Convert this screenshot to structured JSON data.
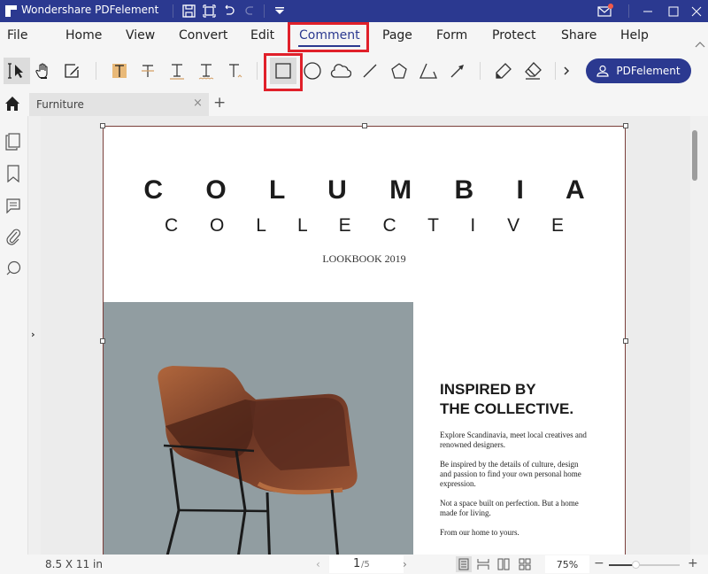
{
  "app": {
    "title": "Wondershare PDFelement",
    "brand_color": "#2b3990",
    "highlight_color": "#e0202a",
    "notification_dot_color": "#f25a4a"
  },
  "quick_access": [
    {
      "icon": "save-icon"
    },
    {
      "icon": "fit-page-icon"
    },
    {
      "icon": "undo-icon"
    },
    {
      "icon": "redo-icon"
    },
    {
      "icon": "customize-dropdown-icon"
    }
  ],
  "window_controls": [
    {
      "icon": "mail-icon",
      "has_notification": true
    },
    {
      "icon": "minimize-icon"
    },
    {
      "icon": "maximize-icon"
    },
    {
      "icon": "close-icon"
    }
  ],
  "menu": {
    "items": [
      {
        "label": "File"
      },
      {
        "label": "Home"
      },
      {
        "label": "View"
      },
      {
        "label": "Convert"
      },
      {
        "label": "Edit"
      },
      {
        "label": "Comment",
        "active": true
      },
      {
        "label": "Page"
      },
      {
        "label": "Form"
      },
      {
        "label": "Protect"
      },
      {
        "label": "Share"
      },
      {
        "label": "Help"
      }
    ],
    "collapse_icon": "chevron-up-icon"
  },
  "toolbar": {
    "tools": [
      {
        "name": "select-tool",
        "icon": "select-cursor-icon",
        "selected": true
      },
      {
        "name": "hand-tool",
        "icon": "hand-icon"
      },
      {
        "name": "edit-tool",
        "icon": "edit-box-icon"
      },
      {
        "name": "highlight-tool",
        "icon": "highlight-icon"
      },
      {
        "name": "strikethrough-tool",
        "icon": "strikethrough-icon"
      },
      {
        "name": "underline-tool",
        "icon": "underline-icon"
      },
      {
        "name": "squiggly-tool",
        "icon": "squiggly-underline-icon"
      },
      {
        "name": "caret-tool",
        "icon": "insert-text-icon"
      },
      {
        "name": "rectangle-tool",
        "icon": "rectangle-icon",
        "selected": true,
        "highlighted": true
      },
      {
        "name": "oval-tool",
        "icon": "circle-icon"
      },
      {
        "name": "cloud-tool",
        "icon": "cloud-icon"
      },
      {
        "name": "line-tool",
        "icon": "line-icon"
      },
      {
        "name": "polygon-tool",
        "icon": "pentagon-icon"
      },
      {
        "name": "polyline-tool",
        "icon": "polyline-icon"
      },
      {
        "name": "arrow-tool",
        "icon": "arrow-icon"
      },
      {
        "name": "pencil-tool",
        "icon": "pencil-icon"
      },
      {
        "name": "eraser-tool",
        "icon": "eraser-icon"
      }
    ],
    "more_icon": "chevron-right-icon",
    "account_button_label": "PDFelement"
  },
  "tabs": {
    "items": [
      {
        "label": "Furniture",
        "close": "×"
      }
    ],
    "new_tab": "+"
  },
  "left_panel": {
    "icons": [
      "thumbnails-icon",
      "bookmark-icon",
      "comments-icon",
      "attachment-icon",
      "search-icon"
    ],
    "expand": "›"
  },
  "document": {
    "title": "C O L U M B I A",
    "subtitle": "C O L L E C T I V E",
    "year_line": "LOOKBOOK 2019",
    "heading_line1": "INSPIRED BY",
    "heading_line2": "THE COLLECTIVE.",
    "paragraphs": [
      "Explore Scandinavia, meet local creatives and renowned designers.",
      "Be inspired by the details of culture, design and passion to find your own personal home expression.",
      "Not a space built on perfection. But a home made for living.",
      "From our home to yours."
    ],
    "image": "leather-armchair-photo"
  },
  "status": {
    "page_size": "8.5 X 11 in",
    "prev": "‹",
    "next": "›",
    "current_page": "1",
    "total_pages": "/5",
    "view_modes": [
      "single-page-icon",
      "continuous-icon",
      "two-page-icon",
      "two-page-continuous-icon"
    ],
    "zoom_level": "75%",
    "zoom_out": "−",
    "zoom_in": "+",
    "zoom_slider_fraction": 0.38
  }
}
